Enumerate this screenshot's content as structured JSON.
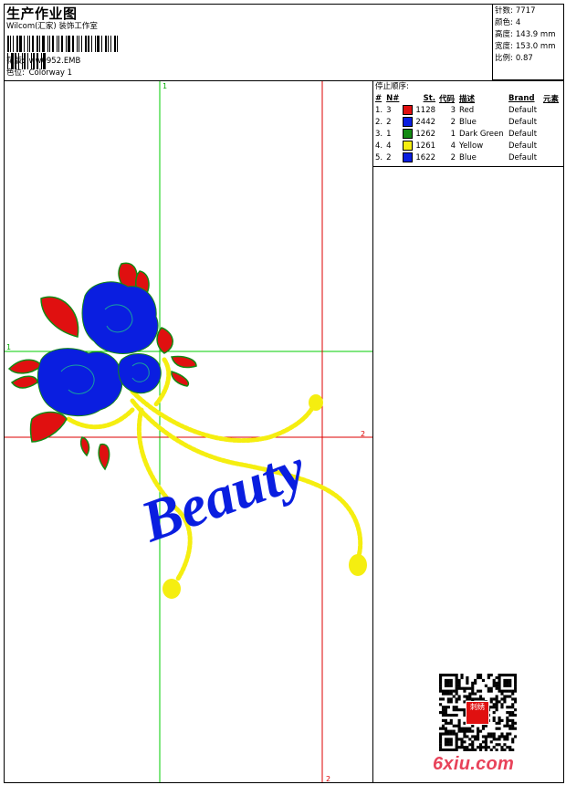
{
  "header": {
    "title": "生产作业图",
    "company": "Wilcom(汇家) 装饰工作室",
    "design_label": "花版:",
    "design_value": "ww0952.EMB",
    "colorway_label": "色位:",
    "colorway_value": "Colorway 1"
  },
  "stats": [
    {
      "label": "针数:",
      "value": "7717"
    },
    {
      "label": "颜色:",
      "value": "4"
    },
    {
      "label": "高度:",
      "value": "143.9 mm"
    },
    {
      "label": "宽度:",
      "value": "153.0 mm"
    },
    {
      "label": "比例:",
      "value": "0.87"
    }
  ],
  "stop_sequence": {
    "title": "停止顺序:",
    "headers": [
      "#",
      "N#",
      "St.",
      "代码",
      "描述",
      "Brand",
      "元素"
    ],
    "rows": [
      {
        "num": "1.",
        "needle": "3",
        "color": "#e01010",
        "stitches": "1128",
        "code": "3",
        "desc": "Red",
        "brand": "Default"
      },
      {
        "num": "2.",
        "needle": "2",
        "color": "#0a1ee0",
        "stitches": "2442",
        "code": "2",
        "desc": "Blue",
        "brand": "Default"
      },
      {
        "num": "3.",
        "needle": "1",
        "color": "#138a13",
        "stitches": "1262",
        "code": "1",
        "desc": "Dark Green",
        "brand": "Default"
      },
      {
        "num": "4.",
        "needle": "4",
        "color": "#f5ee10",
        "stitches": "1261",
        "code": "4",
        "desc": "Yellow",
        "brand": "Default"
      },
      {
        "num": "5.",
        "needle": "2",
        "color": "#0a1ee0",
        "stitches": "1622",
        "code": "2",
        "desc": "Blue",
        "brand": "Default"
      }
    ]
  },
  "canvas": {
    "guide_v1": "1",
    "guide_h1": "1",
    "guide_h2": "2",
    "guide_v2": "2",
    "embroidery_text": "Beauty",
    "color_green_guide": "#00cc00",
    "color_red_guide": "#dd0000"
  },
  "watermark": {
    "site": "6xiu.com",
    "seal_text": "刺绣"
  }
}
